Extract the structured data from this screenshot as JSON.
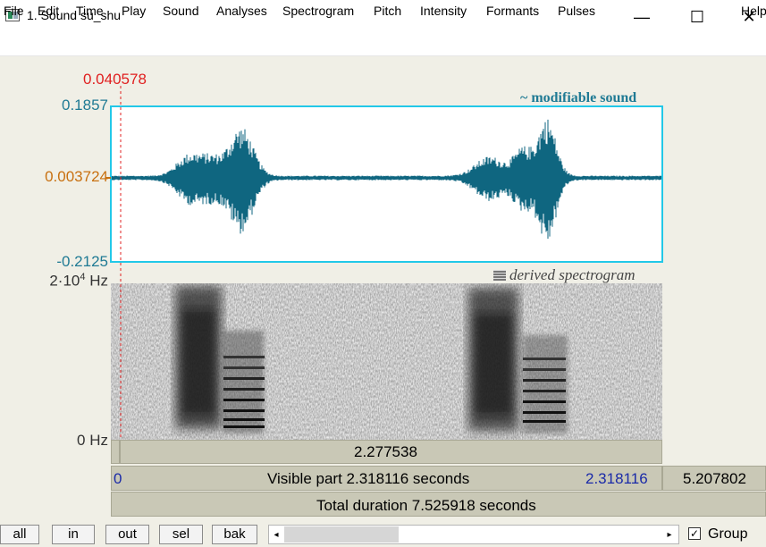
{
  "window": {
    "title": "1. Sound su_shu",
    "controls": {
      "minimize": "—",
      "maximize": "☐",
      "close": "✕"
    }
  },
  "menu": [
    "File",
    "Edit",
    "Time",
    "Play",
    "Sound",
    "Analyses",
    "Spectrogram",
    "Pitch",
    "Intensity",
    "Formants",
    "Pulses",
    "Help"
  ],
  "cursor": {
    "time_label": "0.040578",
    "time": 0.040578
  },
  "waveform": {
    "label": "~ modifiable sound",
    "y_max": "0.1857",
    "y_cursor": "0.003724",
    "y_min": "-0.2125",
    "color": "#0f6680",
    "frame_color": "#22c8e8"
  },
  "spectrogram": {
    "label": "derived spectrogram",
    "y_top_label": "2·10",
    "y_top_exp": "4",
    "y_top_unit": " Hz",
    "y_bottom_label": "0 Hz"
  },
  "bars": {
    "cursor_time": "2.277538",
    "visible_start": "0",
    "visible_text": "Visible part 2.318116 seconds",
    "visible_end": "2.318116",
    "remaining": "5.207802",
    "total_text": "Total duration 7.525918 seconds"
  },
  "buttons": {
    "all": "all",
    "in": "in",
    "out": "out",
    "sel": "sel",
    "bak": "bak"
  },
  "group": {
    "label": "Group",
    "checked": true
  }
}
